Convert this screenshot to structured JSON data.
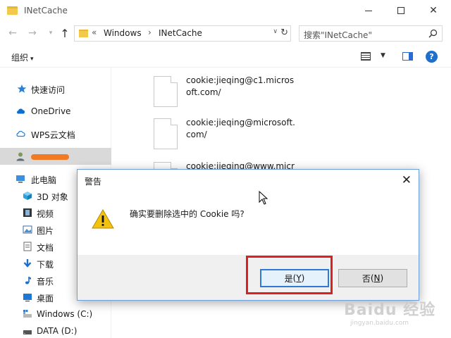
{
  "window": {
    "title": "INetCache"
  },
  "address": {
    "overflow": "«",
    "crumbs": [
      "Windows",
      "INetCache"
    ],
    "separator": "›"
  },
  "search": {
    "placeholder": "搜索\"INetCache\""
  },
  "toolbar": {
    "organize_label": "组织",
    "organize_caret": "▾"
  },
  "sidebar": {
    "items": [
      {
        "label": "快速访问",
        "icon": "star-icon"
      },
      {
        "label": "OneDrive",
        "icon": "cloud-icon"
      },
      {
        "label": "WPS云文档",
        "icon": "cloud-outline-icon"
      },
      {
        "label": "",
        "icon": "user-icon",
        "selected": true
      },
      {
        "label": "此电脑",
        "icon": "computer-icon"
      },
      {
        "label": "3D 对象",
        "icon": "cube-icon"
      },
      {
        "label": "视频",
        "icon": "film-icon"
      },
      {
        "label": "图片",
        "icon": "picture-icon"
      },
      {
        "label": "文档",
        "icon": "document-icon"
      },
      {
        "label": "下载",
        "icon": "download-icon"
      },
      {
        "label": "音乐",
        "icon": "music-icon"
      },
      {
        "label": "桌面",
        "icon": "desktop-icon"
      },
      {
        "label": "Windows (C:)",
        "icon": "drive-c-icon"
      },
      {
        "label": "DATA (D:)",
        "icon": "drive-d-icon"
      }
    ]
  },
  "files": [
    {
      "name": "cookie:jieqing@c1.microsoft.com/"
    },
    {
      "name": "cookie:jieqing@microsoft.com/"
    },
    {
      "name": "cookie:jieqing@www.micr"
    }
  ],
  "dialog": {
    "title": "警告",
    "close": "✕",
    "message": "确实要删除选中的 Cookie 吗?",
    "yes_label": "是",
    "yes_key": "Y",
    "no_label": "否",
    "no_key": "N"
  },
  "watermark": {
    "text": "Baidu 经验",
    "sub": "jingyan.baidu.com"
  },
  "colors": {
    "accent": "#2f79d9",
    "highlight": "#dc1f1f",
    "redaction": "#f27a22",
    "folder": "#f3c94b"
  }
}
